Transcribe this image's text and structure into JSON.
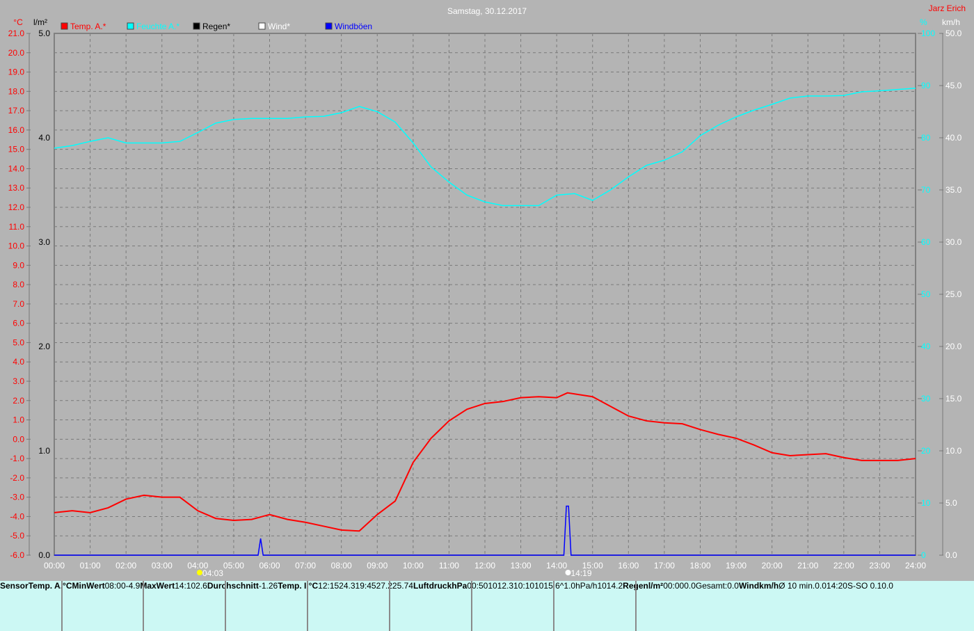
{
  "header": {
    "title": "Samstag, 30.12.2017",
    "author": "Jarz Erich"
  },
  "legend": [
    {
      "label": "Temp. A.*",
      "color": "#ff0000"
    },
    {
      "label": "Feuchte A.*",
      "color": "#00ffff"
    },
    {
      "label": "Regen*",
      "color": "#000000"
    },
    {
      "label": "Wind*",
      "color": "#ffffff"
    },
    {
      "label": "Windböen",
      "color": "#0000ff"
    }
  ],
  "chart_data": {
    "type": "line",
    "title": "Samstag, 30.12.2017",
    "x_unit": "hours",
    "x_ticks": [
      "00:00",
      "01:00",
      "02:00",
      "03:00",
      "04:00",
      "05:00",
      "06:00",
      "07:00",
      "08:00",
      "09:00",
      "10:00",
      "11:00",
      "12:00",
      "13:00",
      "14:00",
      "15:00",
      "16:00",
      "17:00",
      "18:00",
      "19:00",
      "20:00",
      "21:00",
      "22:00",
      "23:00",
      "24:00"
    ],
    "axes": {
      "temp": {
        "unit": "°C",
        "range": [
          -6,
          21
        ],
        "color": "#ff0000"
      },
      "rain": {
        "unit": "l/m²",
        "range": [
          0,
          5
        ],
        "color": "#000000"
      },
      "humidity": {
        "unit": "%",
        "range": [
          0,
          100
        ],
        "color": "#00ffff"
      },
      "wind": {
        "unit": "km/h",
        "range": [
          0,
          50
        ],
        "color": "#ffffff"
      }
    },
    "grid": true,
    "legend_position": "top-left",
    "markers": [
      {
        "time": "04:03",
        "label": "04:03",
        "icon": "sunrise-icon"
      },
      {
        "time": "14:19",
        "label": "14:19",
        "icon": "sunset-icon"
      }
    ],
    "series": [
      {
        "name": "Temp. A.*",
        "axis": "temp",
        "color": "#ff0000",
        "x": [
          0,
          0.5,
          1,
          1.5,
          2,
          2.5,
          3,
          3.5,
          4,
          4.5,
          5,
          5.5,
          6,
          6.5,
          7,
          7.5,
          8,
          8.5,
          9,
          9.5,
          10,
          10.5,
          11,
          11.5,
          12,
          12.5,
          13,
          13.5,
          14,
          14.3,
          15,
          15.5,
          16,
          16.5,
          17,
          17.5,
          18,
          18.5,
          19,
          19.5,
          20,
          20.5,
          21,
          21.5,
          22,
          22.5,
          23,
          23.5,
          24
        ],
        "y": [
          -3.8,
          -3.7,
          -3.8,
          -3.55,
          -3.1,
          -2.9,
          -3.0,
          -3.0,
          -3.7,
          -4.1,
          -4.2,
          -4.15,
          -3.9,
          -4.15,
          -4.3,
          -4.5,
          -4.7,
          -4.75,
          -3.9,
          -3.2,
          -1.2,
          0.05,
          0.95,
          1.55,
          1.85,
          1.95,
          2.15,
          2.2,
          2.15,
          2.4,
          2.2,
          1.7,
          1.2,
          0.95,
          0.85,
          0.8,
          0.5,
          0.25,
          0.05,
          -0.3,
          -0.7,
          -0.85,
          -0.8,
          -0.75,
          -0.95,
          -1.1,
          -1.1,
          -1.1,
          -1.0
        ]
      },
      {
        "name": "Feuchte A.*",
        "axis": "humidity",
        "color": "#00ffff",
        "x": [
          0,
          0.5,
          1,
          1.5,
          2,
          2.5,
          3,
          3.5,
          4,
          4.5,
          5,
          5.5,
          6,
          6.5,
          7,
          7.5,
          8,
          8.5,
          9,
          9.5,
          10,
          10.5,
          11,
          11.5,
          12,
          12.5,
          13,
          13.5,
          14,
          14.5,
          15,
          15.5,
          16,
          16.5,
          17,
          17.5,
          18,
          18.5,
          19,
          19.5,
          20,
          20.5,
          21,
          21.5,
          22,
          22.5,
          23,
          24
        ],
        "y": [
          78,
          78.5,
          79.3,
          80,
          79,
          79,
          79,
          79.3,
          81,
          82.8,
          83.5,
          83.7,
          83.7,
          83.7,
          84,
          84.1,
          84.8,
          86,
          85,
          83,
          79,
          74.4,
          71.5,
          69,
          67.7,
          67,
          67,
          67,
          69,
          69.3,
          68,
          70,
          72.5,
          74.7,
          75.7,
          77.3,
          80.4,
          82.4,
          84,
          85.3,
          86.4,
          87.6,
          88,
          88,
          88.1,
          88.8,
          89,
          89.5
        ]
      },
      {
        "name": "Regen*",
        "axis": "rain",
        "color": "#000000",
        "x": [
          0,
          24
        ],
        "y": [
          0,
          0
        ]
      },
      {
        "name": "Wind*",
        "axis": "wind",
        "color": "#ffffff",
        "x": [
          0,
          24
        ],
        "y": [
          0,
          0
        ]
      },
      {
        "name": "Windböen",
        "axis": "wind",
        "color": "#0000ff",
        "x": [
          0,
          5.68,
          5.75,
          5.82,
          14.2,
          14.27,
          14.33,
          14.4,
          24
        ],
        "y": [
          0,
          0,
          1.6,
          0,
          0,
          4.7,
          4.7,
          0,
          0
        ]
      }
    ]
  },
  "table": {
    "temp_out": {
      "header": [
        "Sensor",
        "Temp. A.",
        "°C"
      ],
      "rows": [
        [
          "MinWert",
          "08:00",
          "-4.9"
        ],
        [
          "MaxWert",
          "14:10",
          "2.6"
        ],
        [
          "Durchschnitt",
          "",
          "-1.26"
        ]
      ]
    },
    "temp_in": {
      "header": [
        "Temp. I.",
        "°C"
      ],
      "rows": [
        [
          "12:15",
          "24.3"
        ],
        [
          "19:45",
          "27.2"
        ],
        [
          "",
          "25.74"
        ]
      ]
    },
    "pressure": {
      "header": [
        "Luftdruck",
        "hPa"
      ],
      "rows": [
        [
          "00:50",
          "1012.3"
        ],
        [
          "10:10",
          "1015.6"
        ],
        [
          "^1.0hPa/h",
          "1014.2"
        ]
      ]
    },
    "rain": {
      "header": [
        "Regen",
        "l/m²"
      ],
      "rows": [
        [
          "",
          ""
        ],
        [
          "00:00",
          "0.0"
        ],
        [
          "Gesamt:",
          "0.0"
        ]
      ]
    },
    "wind": {
      "header": [
        "Wind",
        "km/h"
      ],
      "rows": [
        [
          "Ø 10 min.",
          "0.0"
        ],
        [
          "14:20",
          "S-SO 0.1"
        ],
        [
          "",
          "0.0"
        ]
      ]
    }
  }
}
